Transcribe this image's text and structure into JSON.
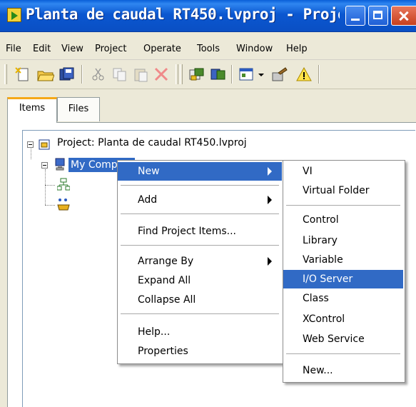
{
  "window": {
    "title": "Planta de caudal RT450.lvproj - Projec...",
    "icon": "labview-project-icon"
  },
  "menubar": [
    "File",
    "Edit",
    "View",
    "Project",
    "Operate",
    "Tools",
    "Window",
    "Help"
  ],
  "toolbar_icons": [
    "new-icon",
    "open-icon",
    "save-all-icon",
    "cut-icon",
    "copy-icon",
    "paste-icon",
    "delete-icon",
    "build-icon",
    "deploy-icon",
    "view-icon",
    "properties-icon",
    "warning-icon"
  ],
  "tabs": [
    {
      "label": "Items",
      "active": true
    },
    {
      "label": "Files",
      "active": false
    }
  ],
  "tree": {
    "root": "Project: Planta de caudal RT450.lvproj",
    "computer": "My Computer"
  },
  "context_menu": {
    "items": [
      {
        "label": "New",
        "submenu": true,
        "selected": true
      },
      {
        "label": "Add",
        "submenu": true
      },
      {
        "label": "Find Project Items..."
      },
      {
        "label": "Arrange By",
        "submenu": true
      },
      {
        "label": "Expand All"
      },
      {
        "label": "Collapse All"
      },
      {
        "label": "Help..."
      },
      {
        "label": "Properties"
      }
    ]
  },
  "submenu": {
    "items": [
      {
        "label": "VI"
      },
      {
        "label": "Virtual Folder"
      },
      {
        "label": "Control"
      },
      {
        "label": "Library"
      },
      {
        "label": "Variable"
      },
      {
        "label": "I/O Server",
        "selected": true
      },
      {
        "label": "Class"
      },
      {
        "label": "XControl"
      },
      {
        "label": "Web Service"
      },
      {
        "label": "New..."
      }
    ]
  },
  "colors": {
    "titlebar": "#0A5FD8",
    "selection": "#316AC5",
    "chrome": "#ECE9D8"
  }
}
